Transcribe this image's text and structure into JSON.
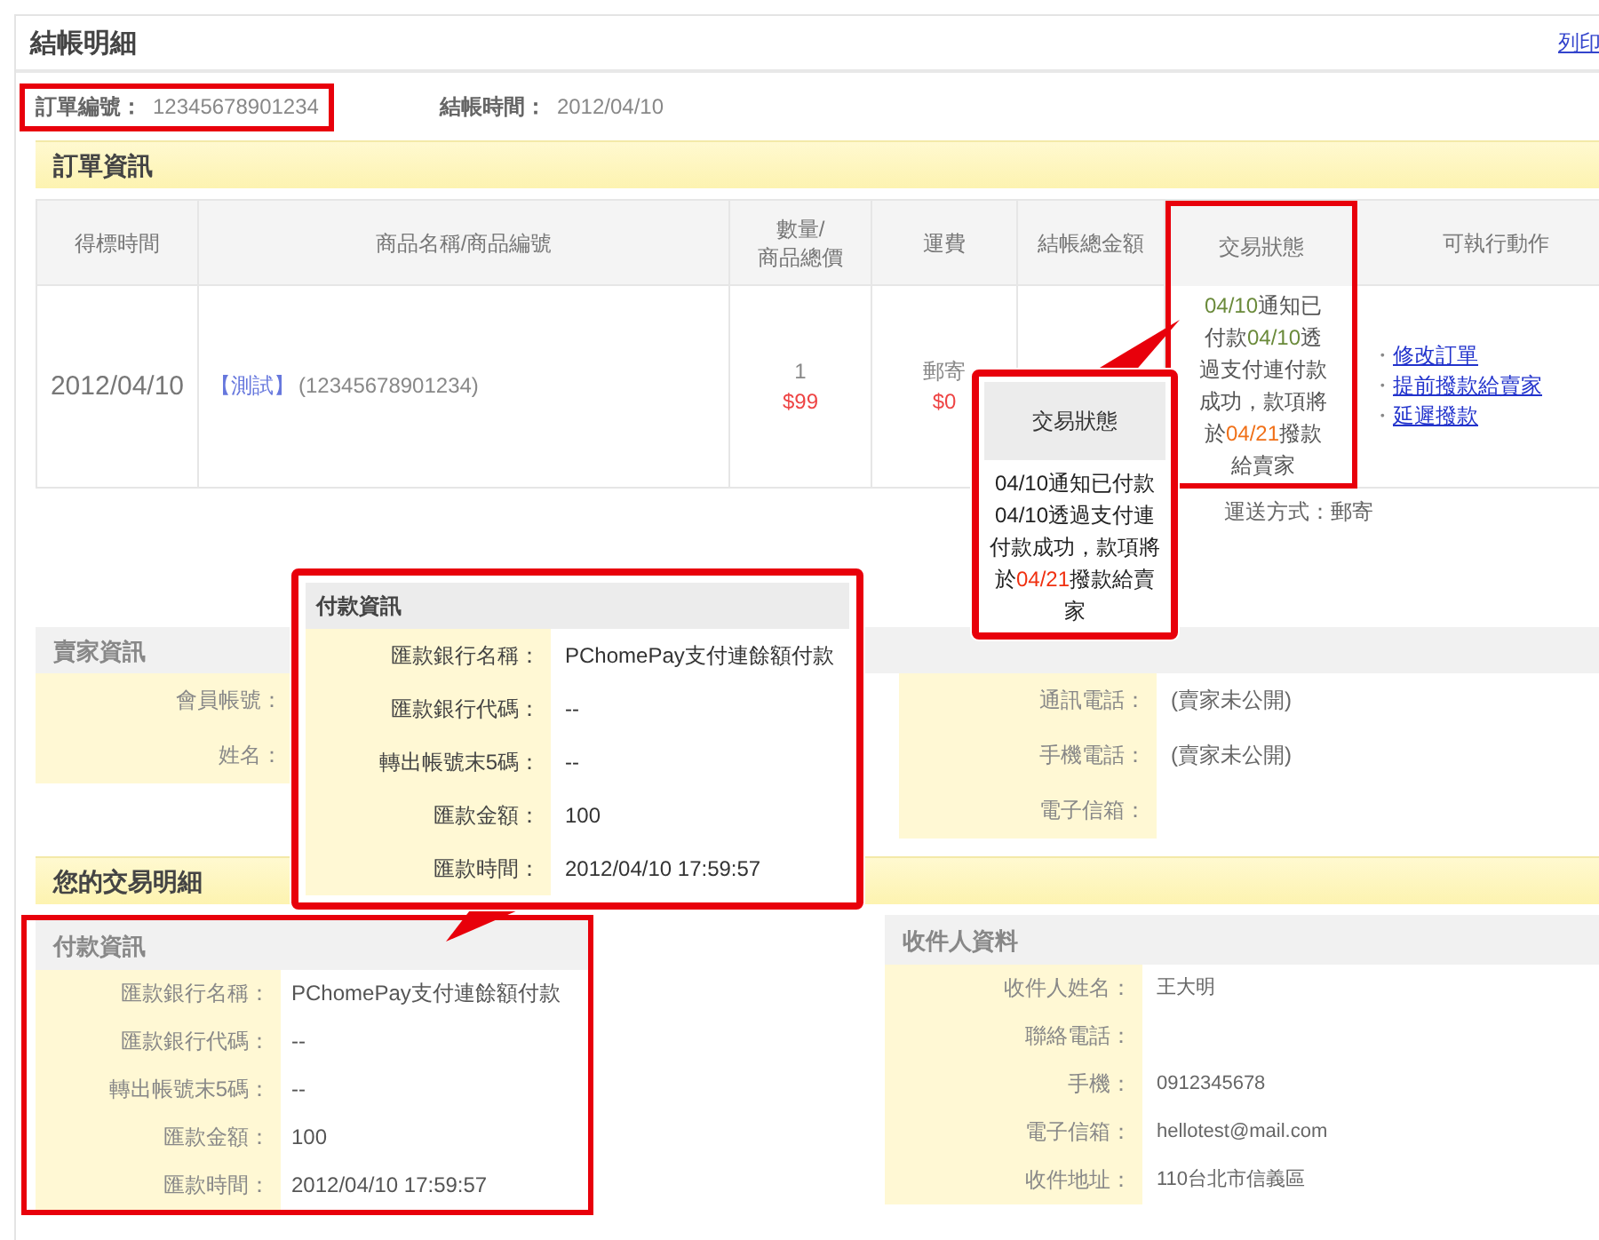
{
  "page": {
    "title": "結帳明細",
    "print_link": "列印"
  },
  "summary": [
    {
      "label": "訂單編號：",
      "value": "12345678901234",
      "highlighted": true
    },
    {
      "label": "結帳時間：",
      "value": "2012/04/10",
      "highlighted": false
    }
  ],
  "order_section": {
    "title": "訂單資訊",
    "columns": [
      {
        "label": "得標時間",
        "highlighted": false
      },
      {
        "label": "商品名稱/商品編號",
        "highlighted": false
      },
      {
        "label": "數量/\n商品總價",
        "highlighted": false
      },
      {
        "label": "運費",
        "highlighted": false
      },
      {
        "label": "結帳總金額",
        "highlighted": false
      },
      {
        "label": "交易狀態",
        "highlighted": true
      },
      {
        "label": "可執行動作",
        "highlighted": false
      }
    ],
    "row": {
      "won_date": "2012/04/10",
      "product_tag": "【測試】",
      "product_code": "(12345678901234)",
      "quantity": "1",
      "total": "$99",
      "shipping": "郵寄",
      "shipping_fee": "$0",
      "status": [
        {
          "text": "04/10",
          "kind": "date"
        },
        {
          "text": "通知已付款",
          "kind": "plain"
        },
        {
          "text": "04/10",
          "kind": "date"
        },
        {
          "text": "透過支付連付款成功，款項將於",
          "kind": "plain"
        },
        {
          "text": "04/21",
          "kind": "due"
        },
        {
          "text": "撥款給賣家",
          "kind": "plain"
        }
      ],
      "actions": [
        {
          "bullet": "・",
          "label": "修改訂單"
        },
        {
          "bullet": "・",
          "label": "提前撥款給賣家"
        },
        {
          "bullet": "・",
          "label": "延遲撥款"
        }
      ]
    },
    "shipping_note": "運送方式：郵寄"
  },
  "seller_section": {
    "title": "賣家資訊",
    "left": [
      {
        "label": "會員帳號："
      },
      {
        "label": "姓名："
      }
    ],
    "right": [
      {
        "label": "通訊電話：",
        "value": "(賣家未公開)"
      },
      {
        "label": "手機電話：",
        "value": "(賣家未公開)"
      },
      {
        "label": "電子信箱："
      }
    ]
  },
  "transaction_section": {
    "title": "您的交易明細",
    "payment": {
      "title": "付款資訊",
      "highlighted": true,
      "fields": [
        {
          "label": "匯款銀行名稱：",
          "value": "PChomePay支付連餘額付款"
        },
        {
          "label": "匯款銀行代碼：",
          "value": "--"
        },
        {
          "label": "轉出帳號末5碼：",
          "value": "--"
        },
        {
          "label": "匯款金額：",
          "value": "100"
        },
        {
          "label": "匯款時間：",
          "value": "2012/04/10 17:59:57"
        }
      ]
    },
    "recipient": {
      "title": "收件人資料",
      "fields": [
        {
          "label": "收件人姓名：",
          "value": "王大明"
        },
        {
          "label": "聯絡電話："
        },
        {
          "label": "手機：",
          "value": "0912345678"
        },
        {
          "label": "電子信箱：",
          "value": "hellotest@mail.com"
        },
        {
          "label": "收件地址：",
          "value": "110台北市信義區"
        }
      ]
    }
  },
  "callouts": [
    {
      "kind": "fields",
      "title": "付款資訊",
      "fields": [
        {
          "label": "匯款銀行名稱：",
          "value": "PChomePay支付連餘額付款"
        },
        {
          "label": "匯款銀行代碼：",
          "value": "--"
        },
        {
          "label": "轉出帳號末5碼：",
          "value": "--"
        },
        {
          "label": "匯款金額：",
          "value": "100"
        },
        {
          "label": "匯款時間：",
          "value": "2012/04/10 17:59:57"
        }
      ]
    },
    {
      "kind": "status",
      "title": "交易狀態",
      "status": [
        {
          "text": "04/10",
          "kind": "date"
        },
        {
          "text": "通知已付款",
          "kind": "plain"
        },
        {
          "text": "04/10",
          "kind": "date"
        },
        {
          "text": "透過支付連付款成功，款項將於",
          "kind": "plain"
        },
        {
          "text": "04/21",
          "kind": "due"
        },
        {
          "text": "撥款給賣家",
          "kind": "plain"
        }
      ]
    }
  ]
}
